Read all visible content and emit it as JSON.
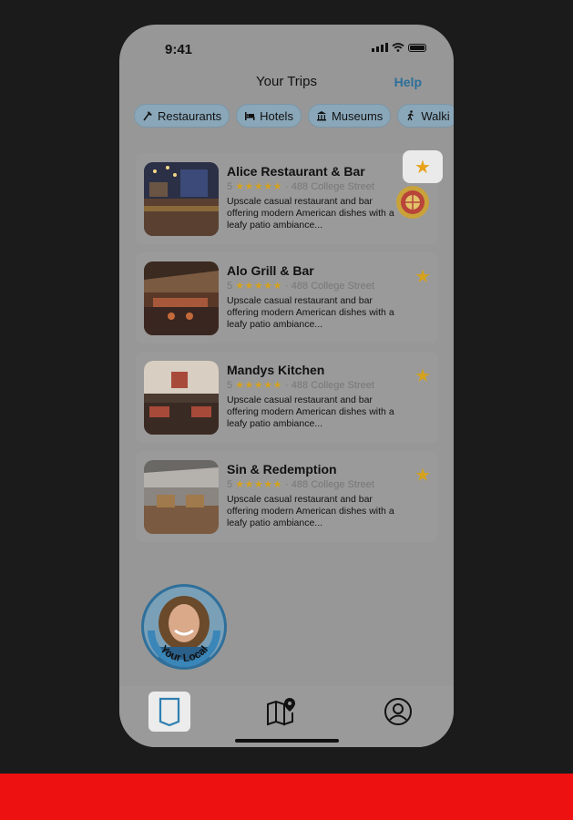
{
  "status": {
    "time": "9:41"
  },
  "header": {
    "title": "Your Trips",
    "help": "Help"
  },
  "chips": [
    {
      "label": "Restaurants",
      "icon": "fork-knife-icon"
    },
    {
      "label": "Hotels",
      "icon": "bed-icon"
    },
    {
      "label": "Museums",
      "icon": "museum-icon"
    },
    {
      "label": "Walki",
      "icon": "walking-icon"
    }
  ],
  "places": [
    {
      "name": "Alice Restaurant & Bar",
      "rating": "5",
      "stars": "★★★★★",
      "address": "· 488 College Street",
      "description": "Upscale casual restaurant and bar offering modern American dishes with a leafy patio ambiance..."
    },
    {
      "name": "Alo Grill & Bar",
      "rating": "5",
      "stars": "★★★★★",
      "address": "· 488 College Street",
      "description": "Upscale casual restaurant and bar offering modern American dishes with a leafy patio ambiance..."
    },
    {
      "name": "Mandys Kitchen",
      "rating": "5",
      "stars": "★★★★★",
      "address": "· 488 College Street",
      "description": "Upscale casual restaurant and bar offering modern American dishes with a leafy patio ambiance..."
    },
    {
      "name": "Sin & Redemption",
      "rating": "5",
      "stars": "★★★★★",
      "address": "· 488 College Street",
      "description": "Upscale casual restaurant and bar offering modern American dishes with a leafy patio ambiance..."
    }
  ],
  "local": {
    "label": "Your Local"
  },
  "tabs": [
    {
      "name": "bookmark",
      "icon": "bookmark-icon",
      "active": true
    },
    {
      "name": "map",
      "icon": "map-pin-icon",
      "active": false
    },
    {
      "name": "profile",
      "icon": "user-circle-icon",
      "active": false
    }
  ],
  "colors": {
    "accent": "#2b6f9a",
    "star": "#d4a21e",
    "chip": "#8aa7b9",
    "overlay": "#979797",
    "bottom_bar": "#ee1111"
  }
}
